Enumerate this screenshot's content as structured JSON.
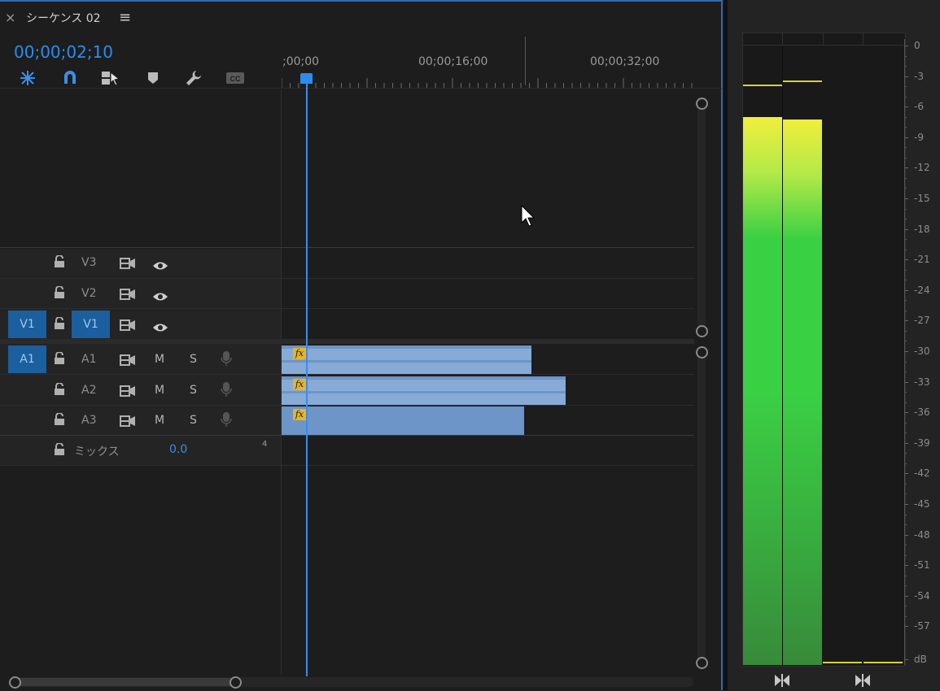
{
  "panel": {
    "close_icon_glyph": "×",
    "title": "シーケンス 02",
    "menu_icon_glyph": "≡",
    "timecode": "00;00;02;10"
  },
  "toolbar": {
    "icons": [
      "insert-snap-icon",
      "magnet-icon",
      "linked-selection-icon",
      "marker-icon",
      "wrench-icon",
      "cc-icon"
    ]
  },
  "ruler": {
    "labels": [
      ";00;00",
      "00;00;16;00",
      "00;00;32;00"
    ]
  },
  "tracks": {
    "video": [
      {
        "label": "V3",
        "source": ""
      },
      {
        "label": "V2",
        "source": ""
      },
      {
        "label": "V1",
        "source": "V1"
      }
    ],
    "audio": [
      {
        "label": "A1",
        "source": "A1",
        "mute": "M",
        "solo": "S"
      },
      {
        "label": "A2",
        "source": "",
        "mute": "M",
        "solo": "S"
      },
      {
        "label": "A3",
        "source": "",
        "mute": "M",
        "solo": "S"
      }
    ],
    "mix": {
      "label": "ミックス",
      "value": "0.0",
      "corner": "4"
    }
  },
  "clips": [
    {
      "track": "A1",
      "badge": "fx"
    },
    {
      "track": "A2",
      "badge": "fx"
    },
    {
      "track": "A3",
      "badge": "fx"
    }
  ],
  "meter": {
    "scale": [
      "0",
      "-3",
      "-6",
      "-9",
      "-12",
      "-15",
      "-18",
      "-21",
      "-24",
      "-27",
      "-30",
      "-33",
      "-36",
      "-39",
      "-42",
      "-45",
      "-48",
      "-51",
      "-54",
      "-57",
      "dB"
    ],
    "levels_db": [
      -7.0,
      -7.3
    ],
    "peaks_db": [
      -3.8,
      -3.4
    ],
    "colors": {
      "top": "#f0ee3c",
      "mid": "#3ad044",
      "bottom": "#388a3a",
      "peak": "#d8d13a"
    }
  },
  "colors": {
    "accent": "#2d8ceb",
    "track_target": "#1b5f9e",
    "clip": "#6d95c7",
    "fx_badge": "#e6b52a"
  }
}
